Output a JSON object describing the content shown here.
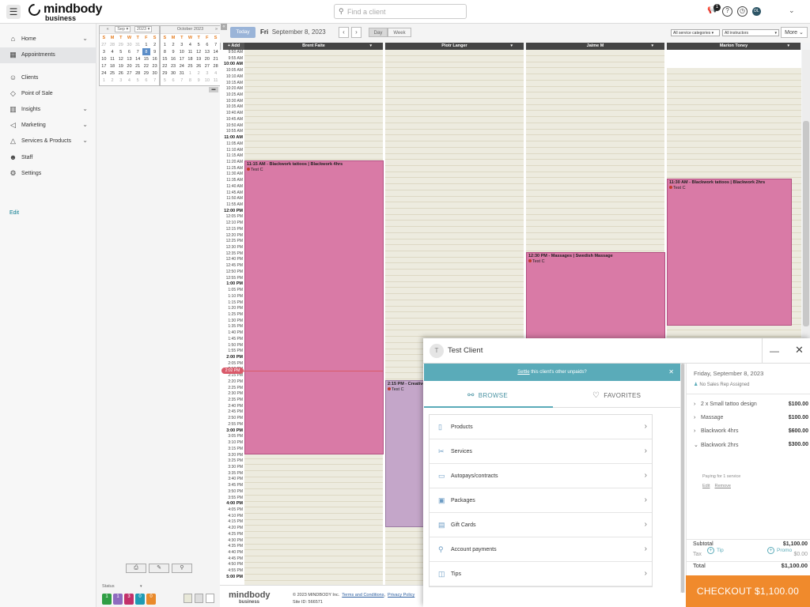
{
  "topbar": {
    "logo_main": "mindbody",
    "logo_sub": "business",
    "search_placeholder": "Find a client",
    "notif_count": "1",
    "avatar_initials": "DL"
  },
  "sidebar": {
    "items": [
      {
        "label": "Home",
        "icon": "home-icon",
        "glyph": "⌂",
        "expand": true
      },
      {
        "label": "Appointments",
        "icon": "calendar-icon",
        "glyph": "▦",
        "expand": false
      },
      {
        "label": "Clients",
        "icon": "user-icon",
        "glyph": "☺",
        "expand": false
      },
      {
        "label": "Point of Sale",
        "icon": "tag-icon",
        "glyph": "◇",
        "expand": false
      },
      {
        "label": "Insights",
        "icon": "bar-chart-icon",
        "glyph": "▥",
        "expand": true
      },
      {
        "label": "Marketing",
        "icon": "megaphone-icon",
        "glyph": "◁",
        "expand": true
      },
      {
        "label": "Services & Products",
        "icon": "shapes-icon",
        "glyph": "△",
        "expand": true
      },
      {
        "label": "Staff",
        "icon": "people-icon",
        "glyph": "☻",
        "expand": false
      },
      {
        "label": "Settings",
        "icon": "gear-icon",
        "glyph": "⚙",
        "expand": false
      }
    ],
    "edit_label": "Edit"
  },
  "minical": {
    "sep": {
      "month_select": "Sep",
      "year_select": "2023",
      "days": [
        "S",
        "M",
        "T",
        "W",
        "T",
        "F",
        "S"
      ],
      "weeks": [
        [
          "27",
          "28",
          "29",
          "30",
          "31",
          "1",
          "2"
        ],
        [
          "3",
          "4",
          "5",
          "6",
          "7",
          "8",
          "9"
        ],
        [
          "10",
          "11",
          "12",
          "13",
          "14",
          "15",
          "16"
        ],
        [
          "17",
          "18",
          "19",
          "20",
          "21",
          "22",
          "23"
        ],
        [
          "24",
          "25",
          "26",
          "27",
          "28",
          "29",
          "30"
        ],
        [
          "1",
          "2",
          "3",
          "4",
          "5",
          "6",
          "7"
        ]
      ]
    },
    "oct": {
      "title": "October 2023",
      "days": [
        "S",
        "M",
        "T",
        "W",
        "T",
        "F",
        "S"
      ],
      "weeks": [
        [
          "1",
          "2",
          "3",
          "4",
          "5",
          "6",
          "7"
        ],
        [
          "8",
          "9",
          "10",
          "11",
          "12",
          "13",
          "14"
        ],
        [
          "15",
          "16",
          "17",
          "18",
          "19",
          "20",
          "21"
        ],
        [
          "22",
          "23",
          "24",
          "25",
          "26",
          "27",
          "28"
        ],
        [
          "29",
          "30",
          "31",
          "1",
          "2",
          "3",
          "4"
        ],
        [
          "5",
          "6",
          "7",
          "8",
          "9",
          "10",
          "11"
        ]
      ]
    }
  },
  "status": {
    "label": "Status",
    "counts": [
      {
        "value": "1",
        "color": "#2f9e44"
      },
      {
        "value": "1",
        "color": "#8e6bbf"
      },
      {
        "value": "3",
        "color": "#c2306a"
      },
      {
        "value": "0",
        "color": "#1f9bb4"
      },
      {
        "value": "0",
        "color": "#e98a2b"
      }
    ]
  },
  "schedule": {
    "today_label": "Today",
    "day_name": "Fri",
    "date_label": "September 8, 2023",
    "view_day": "Day",
    "view_week": "Week",
    "service_filter": "All service categories",
    "instructor_filter": "All instructors",
    "more_label": "More",
    "add_label": "+ Add",
    "columns": [
      "Brent Faite",
      "Piotr Langer",
      "Jaime M",
      "Marion Toney"
    ],
    "now_label": "2:02 PM",
    "times": [
      "9:50 AM",
      "9:55 AM",
      "10:00 AM",
      "10:05 AM",
      "10:10 AM",
      "10:15 AM",
      "10:20 AM",
      "10:25 AM",
      "10:30 AM",
      "10:35 AM",
      "10:40 AM",
      "10:45 AM",
      "10:50 AM",
      "10:55 AM",
      "11:00 AM",
      "11:05 AM",
      "11:10 AM",
      "11:15 AM",
      "11:20 AM",
      "11:25 AM",
      "11:30 AM",
      "11:35 AM",
      "11:40 AM",
      "11:45 AM",
      "11:50 AM",
      "11:55 AM",
      "12:00 PM",
      "12:05 PM",
      "12:10 PM",
      "12:15 PM",
      "12:20 PM",
      "12:25 PM",
      "12:30 PM",
      "12:35 PM",
      "12:40 PM",
      "12:45 PM",
      "12:50 PM",
      "12:55 PM",
      "1:00 PM",
      "1:05 PM",
      "1:10 PM",
      "1:15 PM",
      "1:20 PM",
      "1:25 PM",
      "1:30 PM",
      "1:35 PM",
      "1:40 PM",
      "1:45 PM",
      "1:50 PM",
      "1:55 PM",
      "2:00 PM",
      "2:05 PM",
      "2:10 PM",
      "2:15 PM",
      "2:20 PM",
      "2:25 PM",
      "2:30 PM",
      "2:35 PM",
      "2:40 PM",
      "2:45 PM",
      "2:50 PM",
      "2:55 PM",
      "3:00 PM",
      "3:05 PM",
      "3:10 PM",
      "3:15 PM",
      "3:20 PM",
      "3:25 PM",
      "3:30 PM",
      "3:35 PM",
      "3:40 PM",
      "3:45 PM",
      "3:50 PM",
      "3:55 PM",
      "4:00 PM",
      "4:05 PM",
      "4:10 PM",
      "4:15 PM",
      "4:20 PM",
      "4:25 PM",
      "4:30 PM",
      "4:35 PM",
      "4:40 PM",
      "4:45 PM",
      "4:50 PM",
      "4:55 PM",
      "5:00 PM"
    ],
    "appointments": [
      {
        "title": "11:15 AM - Blackwork tattoos | Blackwork 4hrs",
        "client": "Test C",
        "color": "#d97aa6"
      },
      {
        "title": "12:30 PM - Massages | Swedish Massage",
        "client": "Test C",
        "color": "#d97aa6"
      },
      {
        "title": "11:30 AM - Blackwork tattoos | Blackwork 2hrs",
        "client": "Test C",
        "color": "#d97aa6"
      },
      {
        "title": "2:15 PM - Creative",
        "client": "Test C",
        "color": "#c4a6c9"
      }
    ]
  },
  "footer": {
    "logo_main": "mindbody",
    "logo_sub": "business",
    "copyright": "© 2023 MINDBODY Inc.",
    "terms": "Terms and Conditions",
    "privacy": "Privacy Policy",
    "site_id": "Site ID: 566571"
  },
  "checkout": {
    "client_initial": "T",
    "client_name": "Test Client",
    "settle_link": "Settle",
    "settle_rest": " this client's other unpaids?",
    "tab_browse": "BROWSE",
    "tab_favorites": "FAVORITES",
    "menu": [
      {
        "label": "Products",
        "icon": "bottle-icon",
        "glyph": "▯"
      },
      {
        "label": "Services",
        "icon": "scissors-icon",
        "glyph": "✂"
      },
      {
        "label": "Autopays/contracts",
        "icon": "contract-icon",
        "glyph": "▭"
      },
      {
        "label": "Packages",
        "icon": "package-icon",
        "glyph": "▣"
      },
      {
        "label": "Gift Cards",
        "icon": "gift-icon",
        "glyph": "▤"
      },
      {
        "label": "Account payments",
        "icon": "wallet-icon",
        "glyph": "⚲"
      },
      {
        "label": "Tips",
        "icon": "tip-jar-icon",
        "glyph": "◫"
      }
    ],
    "date": "Friday, September 8, 2023",
    "sales_rep": "No Sales Rep Assigned",
    "items": [
      {
        "label": "2 x Small tattoo design",
        "price": "$100.00",
        "arrow": "›"
      },
      {
        "label": "Massage",
        "price": "$100.00",
        "arrow": "›"
      },
      {
        "label": "Blackwork 4hrs",
        "price": "$600.00",
        "arrow": "›"
      },
      {
        "label": "Blackwork 2hrs",
        "price": "$300.00",
        "arrow": "⌄"
      }
    ],
    "paying_note": "Paying for 1 service",
    "edit_link": "Edit",
    "remove_link": "Remove",
    "tip_label": "Tip",
    "promo_label": "Promo",
    "subtotal_label": "Subtotal",
    "subtotal_value": "$1,100.00",
    "tax_label": "Tax",
    "tax_value": "$0.00",
    "total_label": "Total",
    "total_value": "$1,100.00",
    "checkout_label": "CHECKOUT $1,100.00"
  }
}
